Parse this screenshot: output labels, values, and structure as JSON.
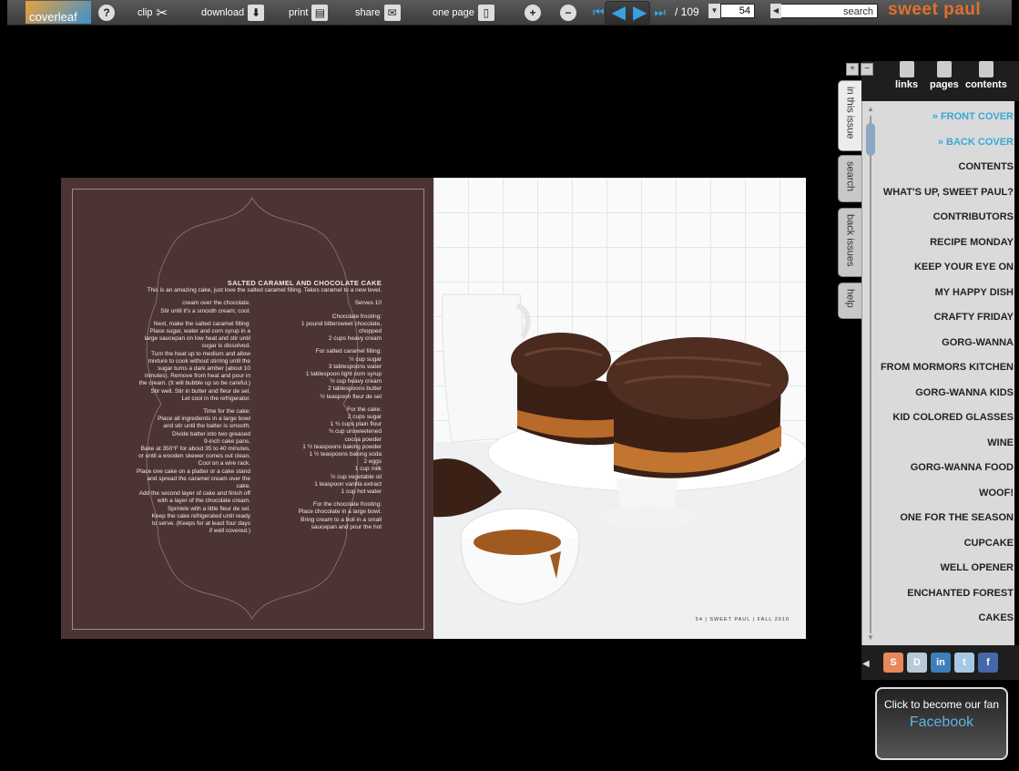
{
  "toolbar": {
    "brand": "sweet paul",
    "search_label": "search",
    "current_page": "54",
    "total_pages": "/ 109",
    "one_page": "one page",
    "share": "share",
    "print": "print",
    "download": "download",
    "clip": "clip",
    "help": "?",
    "coverleaf": "coverleaf"
  },
  "spread": {
    "recipe": {
      "title": "SALTED CARAMEL AND CHOCOLATE CAKE",
      "intro": "This is an amazing cake, just love the salted caramel filling. Takes caramel to a new level.",
      "serves": "Serves 10",
      "col_a": [
        "Chocolate frosting:",
        "1 pound bittersweet chocolate,",
        "chopped",
        "2 cups heavy cream",
        "",
        "For salted caramel filling:",
        "½ cup sugar",
        "3 tablespoons water",
        "1 tablespoon light corn syrup",
        "½ cup heavy cream",
        "2 tablespoons butter",
        "½ teaspoon fleur de sel",
        "",
        "For the cake:",
        "2 cups sugar",
        "1 ¾ cups plain flour",
        "¾ cup unsweetened",
        "cocoa powder",
        "1 ½ teaspoons baking powder",
        "1 ½ teaspoons baking soda",
        "2 eggs",
        "1 cup milk",
        "½ cup vegetable oil",
        "1 teaspoon vanilla extract",
        "1 cup hot water",
        "",
        "For the chocolate frosting:",
        "Place chocolate in a large bowl.",
        "Bring cream to a boil in a small",
        "saucepan and pour the hot"
      ],
      "col_b": [
        "cream over the chocolate.",
        "Stir until it's a smooth cream; cool.",
        "",
        "Next, make the salted caramel filling:",
        "Place sugar, water and corn syrup in a",
        "large saucepan on low heat and stir until",
        "sugar is dissolved.",
        "Turn the heat up to medium and allow",
        "mixture to cook without stirring until the",
        "sugar turns a dark amber (about 10",
        "minutes). Remove from heat and pour in",
        "the cream. (It will bubble up so be careful.)",
        "Stir well. Stir in butter and fleur de sel.",
        "Let cool in the refrigerator.",
        "",
        "Time for the cake:",
        "Place all ingredients in a large bowl",
        "and stir until the batter is smooth.",
        "Divide batter into two greased",
        "9-inch cake pans.",
        "Bake at 350°F for about 35 to 40 minutes,",
        "or until a wooden skewer comes out clean.",
        "Cool on a wire rack.",
        "Place one cake on a platter or a cake stand",
        "and spread the caramel cream over the cake.",
        "Add the second layer of cake and finish off",
        "with a layer of the chocolate cream.",
        "Sprinkle with a little fleur de sel.",
        "Keep the cake refrigerated until ready",
        "to serve. (Keeps for at least four days",
        "if well covered.)"
      ]
    },
    "folio": "54 | SWEET PAUL | FALL 2010"
  },
  "side_tabs": [
    "in this issue",
    "search",
    "back issues",
    "help"
  ],
  "panel": {
    "header": [
      "contents",
      "pages",
      "links"
    ],
    "toc": [
      {
        "label": "» FRONT COVER",
        "accent": true
      },
      {
        "label": "» BACK COVER",
        "accent": true
      },
      {
        "label": "CONTENTS",
        "accent": false
      },
      {
        "label": "WHAT'S UP, SWEET PAUL?",
        "accent": false
      },
      {
        "label": "CONTRIBUTORS",
        "accent": false
      },
      {
        "label": "RECIPE MONDAY",
        "accent": false
      },
      {
        "label": "KEEP YOUR EYE ON",
        "accent": false
      },
      {
        "label": "MY HAPPY DISH",
        "accent": false
      },
      {
        "label": "CRAFTY FRIDAY",
        "accent": false
      },
      {
        "label": "GORG-WANNA",
        "accent": false
      },
      {
        "label": "FROM MORMORS KITCHEN",
        "accent": false
      },
      {
        "label": "GORG-WANNA KIDS",
        "accent": false
      },
      {
        "label": "KID COLORED GLASSES",
        "accent": false
      },
      {
        "label": "WINE",
        "accent": false
      },
      {
        "label": "GORG-WANNA FOOD",
        "accent": false
      },
      {
        "label": "WOOF!",
        "accent": false
      },
      {
        "label": "ONE FOR THE SEASON",
        "accent": false
      },
      {
        "label": "CUPCAKE",
        "accent": false
      },
      {
        "label": "WELL OPENER",
        "accent": false
      },
      {
        "label": "ENCHANTED FOREST",
        "accent": false
      },
      {
        "label": "CAKES",
        "accent": false
      }
    ],
    "facebook_small": "Click to become our fan",
    "facebook_big": "Facebook"
  },
  "colors": {
    "accent": "#3aa7d6",
    "brand": "#e0702d",
    "page_bg": "#4d3434"
  }
}
